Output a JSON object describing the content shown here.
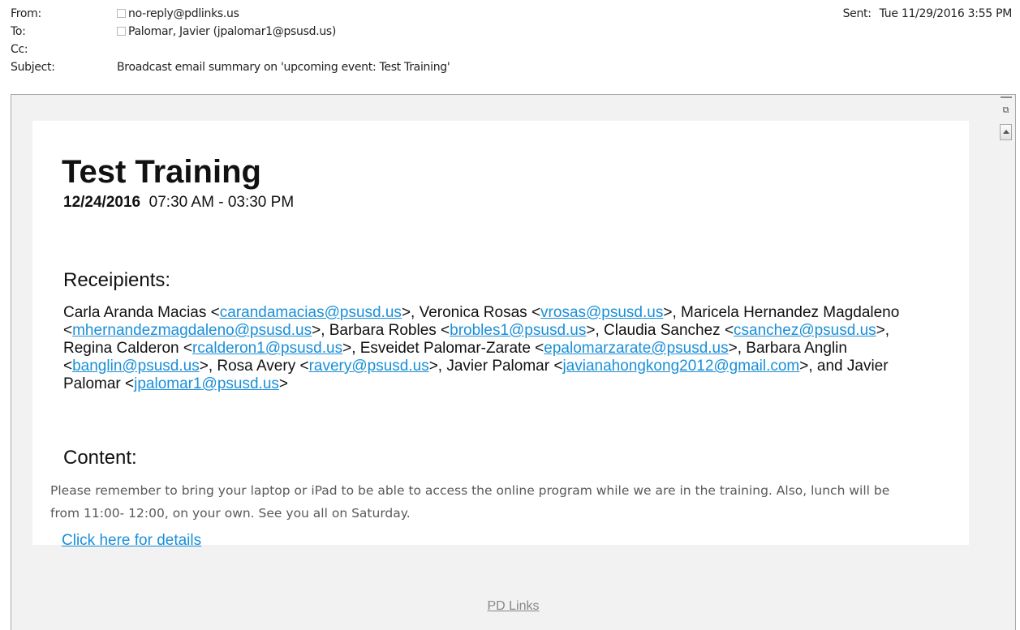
{
  "header": {
    "from_label": "From:",
    "from_value": "no-reply@pdlinks.us",
    "to_label": "To:",
    "to_value": "Palomar, Javier (jpalomar1@psusd.us)",
    "cc_label": "Cc:",
    "subject_label": "Subject:",
    "subject_value": "Broadcast email summary on 'upcoming event: Test Training'",
    "sent_label": "Sent:",
    "sent_value": "Tue 11/29/2016 3:55 PM"
  },
  "body": {
    "event_title": "Test Training",
    "event_date": "12/24/2016",
    "event_time": "07:30 AM - 03:30 PM",
    "recipients_heading": "Receipients:",
    "recipients": {
      "t1": "Carla Aranda Macias <",
      "e1": "carandamacias@psusd.us",
      "t2": ">, Veronica Rosas <",
      "e2": "vrosas@psusd.us",
      "t3": ">, Maricela Hernandez Magdaleno <",
      "e3": "mhernandezmagdaleno@psusd.us",
      "t4": ">, Barbara Robles <",
      "e4": "brobles1@psusd.us",
      "t5": ">, Claudia Sanchez <",
      "e5": "csanchez@psusd.us",
      "t6": ">, Regina Calderon <",
      "e6": "rcalderon1@psusd.us",
      "t7": ">, Esveidet Palomar-Zarate <",
      "e7": "epalomarzarate@psusd.us",
      "t8": ">, Barbara Anglin <",
      "e8": "banglin@psusd.us",
      "t9": ">, Rosa Avery <",
      "e9": "ravery@psusd.us",
      "t10": ">, Javier Palomar <",
      "e10": "javianahongkong2012@gmail.com",
      "t11": ">, and Javier Palomar <",
      "e11": "jpalomar1@psusd.us",
      "t12": ">"
    },
    "content_heading": "Content:",
    "content_text": "Please remember to bring your laptop or iPad to be able to access the online program while we are in the training. Also, lunch will be from 11:00- 12:00, on your own. See you all on Saturday.",
    "details_link": "Click here for details",
    "footer_link": "PD Links"
  },
  "colors": {
    "link": "#1a8fd8",
    "frame_bg": "#f2f2f2",
    "body_text": "#595959"
  }
}
